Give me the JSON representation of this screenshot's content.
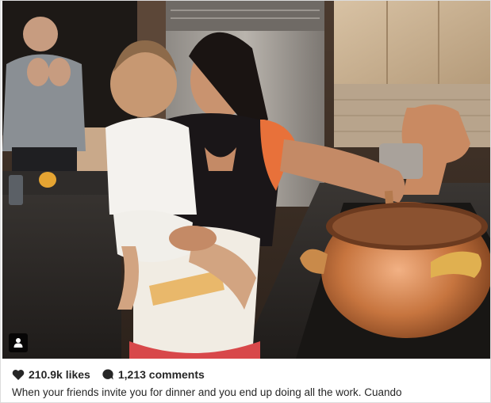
{
  "post": {
    "likes_text": "210.9k likes",
    "comments_text": "1,213 comments",
    "caption": "When your friends invite you for dinner and you end up doing all the work. Cuando"
  },
  "icons": {
    "like": "heart-icon",
    "comment": "comment-bubble-icon",
    "tagged_user": "person-icon"
  },
  "colors": {
    "text": "#262626",
    "copper": "#c27a4a",
    "apron_orange": "#e8713a"
  }
}
